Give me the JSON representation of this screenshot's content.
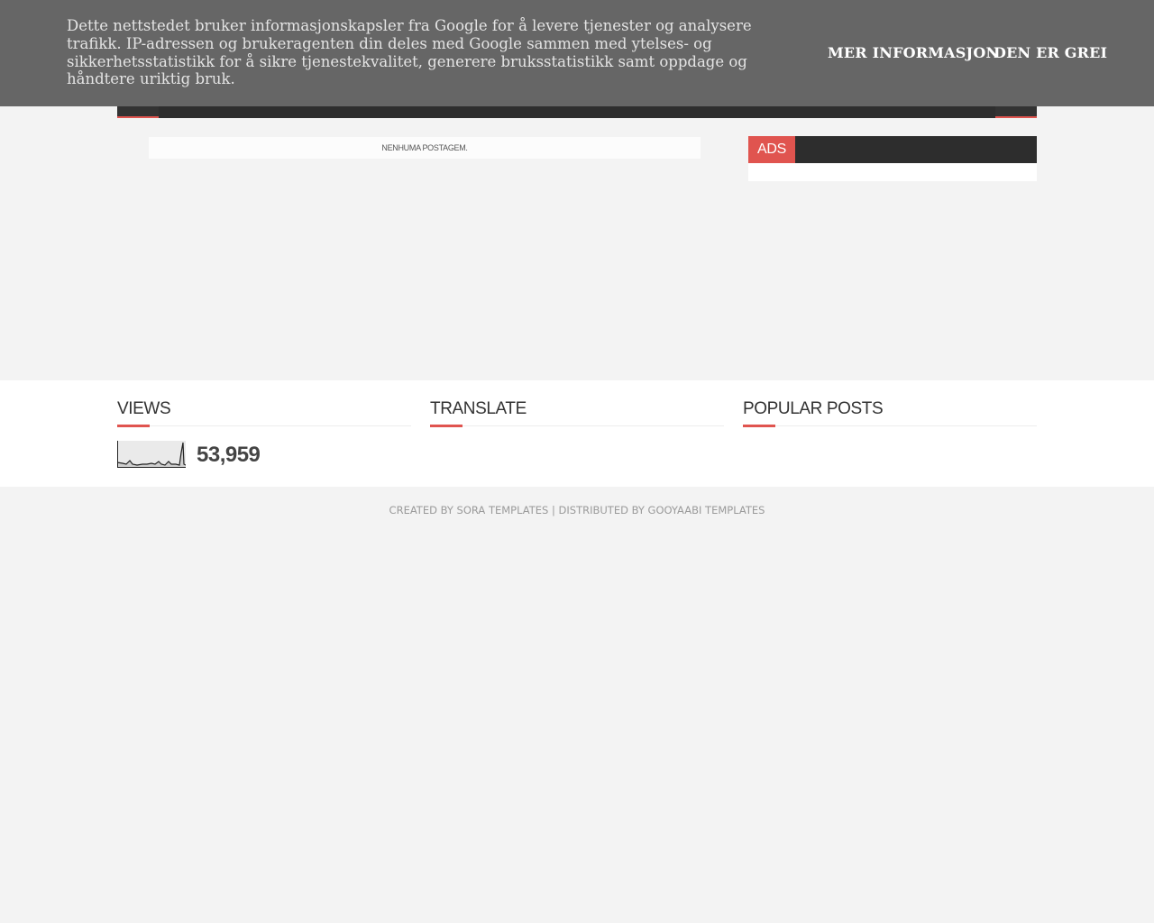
{
  "cookie_banner": {
    "text": "Dette nettstedet bruker informasjonskapsler fra Google for å levere tjenester og analysere trafikk. IP-adressen og brukeragenten din deles med Google sammen med ytelses- og sikkerhetsstatistikk for å sikre tjenestekvalitet, generere bruksstatistikk samt oppdage og håndtere uriktig bruk.",
    "more_info_label": "MER INFORMASJON",
    "accept_label": "DEN ER GREI"
  },
  "main": {
    "no_posts_text": "Nenhuma postagem."
  },
  "sidebar": {
    "ads_title": "ADS"
  },
  "footer": {
    "views_title": "Views",
    "views_count": "53,959",
    "translate_title": "Translate",
    "popular_title": "Popular Posts"
  },
  "credits": {
    "created_by": "Created By Sora Templates",
    "separator": " | ",
    "distributed_by": "Distributed By Gooyaabi Templates"
  },
  "colors": {
    "accent": "#e0544f",
    "banner_bg": "#666666",
    "nav_bg": "#2d2d2d",
    "page_bg": "#f3f3f3"
  }
}
